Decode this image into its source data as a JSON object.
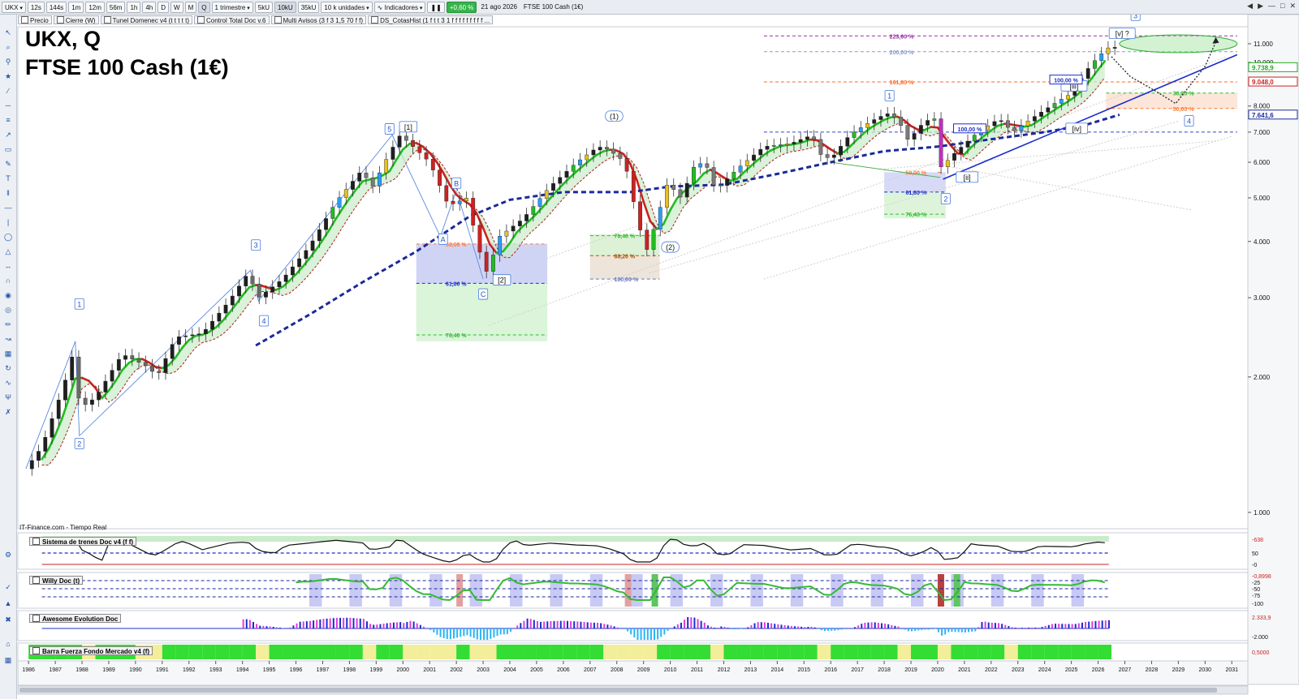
{
  "toolbar": {
    "symbol": "UKX",
    "intervals": [
      "12s",
      "144s",
      "1m",
      "12m",
      "56m",
      "1h",
      "4h",
      "D",
      "W",
      "M",
      "Q"
    ],
    "period": "1 trimestre",
    "units": [
      "5kU",
      "10kU",
      "35kU"
    ],
    "unit_select": "10 k unidades",
    "indicators_label": "Indicadores",
    "change": "+0,60 %",
    "date": "21 ago 2026",
    "instrument": "FTSE 100 Cash (1€)"
  },
  "legend": [
    "Precio",
    "Cierre (W)",
    "Tunel Domenec v4 (t t t t t)",
    "Control Total Doc v.6",
    "Multi Avisos (3 f 3 1,5 70 f f)",
    "DS_CotasHist (1 f t t 3 1 f f f f f f f f f ..."
  ],
  "chart_title": {
    "line1": "UKX, Q",
    "line2": "FTSE 100 Cash (1€)"
  },
  "source": "IT-Finance.com - Tiempo Real",
  "colors": {
    "up": "#1f1f1f",
    "green": "#22bb22",
    "red": "#cc2222",
    "blue": "#1a2ccc",
    "navy": "#1a2a9a",
    "fib_purple": "#9a2aa8",
    "fib_orange": "#ff7a33",
    "fib_green": "#33bb33"
  },
  "chart_data": {
    "type": "candlestick",
    "yscale": "log",
    "ylim": [
      920,
      12000
    ],
    "xlim": [
      1985.6,
      2031.6
    ],
    "y_ticks": [
      {
        "v": 11000,
        "l": "11.000"
      },
      {
        "v": 10000,
        "l": "10.000"
      },
      {
        "v": 8000,
        "l": "8.000"
      },
      {
        "v": 7000,
        "l": "7.000"
      },
      {
        "v": 6000,
        "l": "6.000"
      },
      {
        "v": 5000,
        "l": "5.000"
      },
      {
        "v": 4000,
        "l": "4.000"
      },
      {
        "v": 3000,
        "l": "3.000"
      },
      {
        "v": 2000,
        "l": "2.000"
      },
      {
        "v": 1000,
        "l": "1.000"
      }
    ],
    "price_tags": [
      {
        "v": 9738,
        "l": "9.738,9",
        "c": "#22aa22"
      },
      {
        "v": 9048,
        "l": "9.048,0",
        "c": "#cc2222"
      },
      {
        "v": 7641,
        "l": "7.641,6",
        "c": "#1a2a9a"
      }
    ],
    "x_years": [
      1986,
      1987,
      1988,
      1989,
      1990,
      1991,
      1992,
      1993,
      1994,
      1995,
      1996,
      1997,
      1998,
      1999,
      2000,
      2001,
      2002,
      2003,
      2004,
      2005,
      2006,
      2007,
      2008,
      2009,
      2010,
      2011,
      2012,
      2013,
      2014,
      2015,
      2016,
      2017,
      2018,
      2019,
      2020,
      2021,
      2022,
      2023,
      2024,
      2025,
      2026,
      2027,
      2028,
      2029,
      2030,
      2031
    ],
    "close_path": [
      [
        1985.9,
        1250
      ],
      [
        1986.5,
        1400
      ],
      [
        1987.3,
        1900
      ],
      [
        1987.75,
        2350
      ],
      [
        1987.9,
        1700
      ],
      [
        1988.5,
        1800
      ],
      [
        1989.5,
        2250
      ],
      [
        1990.5,
        2100
      ],
      [
        1990.8,
        2000
      ],
      [
        1991.5,
        2450
      ],
      [
        1992.5,
        2500
      ],
      [
        1993.5,
        2950
      ],
      [
        1994.2,
        3400
      ],
      [
        1994.6,
        3000
      ],
      [
        1995.5,
        3300
      ],
      [
        1996.5,
        3900
      ],
      [
        1997.5,
        4900
      ],
      [
        1998.5,
        5800
      ],
      [
        1998.8,
        5200
      ],
      [
        1999.5,
        6300
      ],
      [
        1999.9,
        6900
      ],
      [
        2000.5,
        6400
      ],
      [
        2001.0,
        6000
      ],
      [
        2001.7,
        4800
      ],
      [
        2002.4,
        5000
      ],
      [
        2002.8,
        3900
      ],
      [
        2003.15,
        3400
      ],
      [
        2003.6,
        4100
      ],
      [
        2004.5,
        4500
      ],
      [
        2005.5,
        5300
      ],
      [
        2006.5,
        6000
      ],
      [
        2007.3,
        6500
      ],
      [
        2007.7,
        6400
      ],
      [
        2008.3,
        6000
      ],
      [
        2008.8,
        4400
      ],
      [
        2009.1,
        3800
      ],
      [
        2009.4,
        4300
      ],
      [
        2009.9,
        5400
      ],
      [
        2010.4,
        5000
      ],
      [
        2010.9,
        5900
      ],
      [
        2011.3,
        6000
      ],
      [
        2011.7,
        5200
      ],
      [
        2012.5,
        5800
      ],
      [
        2013.5,
        6500
      ],
      [
        2014.5,
        6600
      ],
      [
        2015.3,
        6900
      ],
      [
        2015.7,
        6100
      ],
      [
        2016.1,
        6200
      ],
      [
        2016.7,
        6900
      ],
      [
        2017.5,
        7400
      ],
      [
        2018.1,
        7700
      ],
      [
        2018.5,
        7500
      ],
      [
        2018.9,
        6700
      ],
      [
        2019.5,
        7400
      ],
      [
        2019.9,
        7500
      ],
      [
        2020.15,
        5700
      ],
      [
        2020.4,
        6100
      ],
      [
        2020.9,
        6500
      ],
      [
        2021.5,
        7000
      ],
      [
        2022.3,
        7500
      ],
      [
        2022.8,
        7000
      ],
      [
        2023.5,
        7500
      ],
      [
        2024.5,
        8200
      ],
      [
        2025.1,
        8600
      ],
      [
        2025.5,
        9500
      ],
      [
        2026.0,
        10300
      ],
      [
        2026.4,
        10800
      ]
    ],
    "waves": [
      {
        "x": 1987.9,
        "v": 2900,
        "t": "1",
        "st": "box"
      },
      {
        "x": 1987.9,
        "v": 1420,
        "t": "2",
        "st": "box"
      },
      {
        "x": 1994.5,
        "v": 3920,
        "t": "3",
        "st": "box"
      },
      {
        "x": 1994.8,
        "v": 2660,
        "t": "4",
        "st": "box"
      },
      {
        "x": 1999.5,
        "v": 7100,
        "t": "5",
        "st": "box"
      },
      {
        "x": 2000.2,
        "v": 7180,
        "t": "[1]",
        "st": "box"
      },
      {
        "x": 2002.0,
        "v": 5380,
        "t": "B",
        "st": "box"
      },
      {
        "x": 2001.5,
        "v": 4040,
        "t": "A",
        "st": "box"
      },
      {
        "x": 2003.0,
        "v": 3050,
        "t": "C",
        "st": "box"
      },
      {
        "x": 2003.7,
        "v": 3280,
        "t": "[2]",
        "st": "box"
      },
      {
        "x": 2007.9,
        "v": 7580,
        "t": "(1)",
        "st": "round"
      },
      {
        "x": 2010.0,
        "v": 3880,
        "t": "(2)",
        "st": "round"
      },
      {
        "x": 2018.2,
        "v": 8420,
        "t": "1",
        "st": "box"
      },
      {
        "x": 2020.3,
        "v": 4970,
        "t": "2",
        "st": "box"
      },
      {
        "x": 2021.1,
        "v": 5550,
        "t": "[ii]",
        "st": "box"
      },
      {
        "x": 2025.1,
        "v": 8850,
        "t": "[iii]",
        "st": "box"
      },
      {
        "x": 2025.2,
        "v": 7120,
        "t": "[iv]",
        "st": "box"
      },
      {
        "x": 2026.9,
        "v": 11580,
        "t": "[v] ?",
        "st": "box"
      },
      {
        "x": 2027.4,
        "v": 12700,
        "t": "3",
        "st": "box"
      },
      {
        "x": 2029.4,
        "v": 7400,
        "t": "4",
        "st": "box"
      }
    ],
    "fib_lines": [
      {
        "v": 11450,
        "x1": 2013.5,
        "x2": 2031.2,
        "t": "223,60 %",
        "tx": 2018.2,
        "c": "#9a2aa8"
      },
      {
        "v": 10560,
        "x1": 2013.5,
        "x2": 2031.2,
        "t": "200,00 %",
        "tx": 2018.2,
        "c": "#8899cc"
      },
      {
        "v": 9050,
        "x1": 2013.5,
        "x2": 2031.2,
        "t": "161,80 %",
        "tx": 2018.2,
        "c": "#ff6a22"
      },
      {
        "v": 7000,
        "x1": 2013.5,
        "x2": 2031.2,
        "t": "",
        "tx": 0,
        "c": "#3344cc"
      },
      {
        "v": 5700,
        "x1": 2020.0,
        "x2": 2020.2,
        "t": "50,00 %",
        "tx": 2018.8,
        "c": "#ff7a33"
      },
      {
        "v": 5150,
        "x1": 2018.0,
        "x2": 2020.3,
        "t": "61,80 %",
        "tx": 2018.8,
        "c": "#1a2ccc"
      },
      {
        "v": 4600,
        "x1": 2018.0,
        "x2": 2020.3,
        "t": "76,40 %",
        "tx": 2018.8,
        "c": "#33bb33"
      },
      {
        "v": 3950,
        "x1": 2000.5,
        "x2": 2005.4,
        "t": "50,00 %",
        "tx": 2001.6,
        "c": "#ff7a33"
      },
      {
        "v": 3230,
        "x1": 2000.5,
        "x2": 2005.4,
        "t": "61,80 %",
        "tx": 2001.6,
        "c": "#1a2ccc"
      },
      {
        "v": 2480,
        "x1": 2000.5,
        "x2": 2005.4,
        "t": "76,40 %",
        "tx": 2001.6,
        "c": "#33bb33"
      },
      {
        "v": 4120,
        "x1": 2007.0,
        "x2": 2009.6,
        "t": "76,40 %",
        "tx": 2007.9,
        "c": "#33bb33"
      },
      {
        "v": 3720,
        "x1": 2007.0,
        "x2": 2009.6,
        "t": "88,20 %",
        "tx": 2007.9,
        "c": "#aa5500"
      },
      {
        "v": 3300,
        "x1": 2007.0,
        "x2": 2009.6,
        "t": "100,00 %",
        "tx": 2007.9,
        "c": "#6677cc"
      },
      {
        "v": 8550,
        "x1": 2026.3,
        "x2": 2031.2,
        "t": "38,20 %",
        "tx": 2028.8,
        "c": "#33bb33"
      },
      {
        "v": 7900,
        "x1": 2026.3,
        "x2": 2031.2,
        "t": "50,00 %",
        "tx": 2028.8,
        "c": "#ff7a33"
      }
    ],
    "boxed_labels": [
      {
        "x": 2024.8,
        "v": 9140,
        "t": "100,00 %",
        "c": "#1a2ccc"
      },
      {
        "x": 2021.2,
        "v": 7120,
        "t": "100,00 %",
        "c": "#1a2ccc"
      }
    ]
  },
  "panels": [
    {
      "label": "Sistema de trenes Doc v4 (f f)",
      "ticks": [
        "-638",
        "50",
        "-0"
      ]
    },
    {
      "label": "Willy Doc (t)",
      "ticks": [
        "-0,8998",
        "-25",
        "-50",
        "-75",
        "-100"
      ]
    },
    {
      "label": "Awesome Evolution Doc",
      "ticks": [
        "2.333,9",
        "-2.000"
      ]
    },
    {
      "label": "Barra Fuerza Fondo Mercado v4 (f)",
      "ticks": [
        "0,5000"
      ]
    }
  ]
}
